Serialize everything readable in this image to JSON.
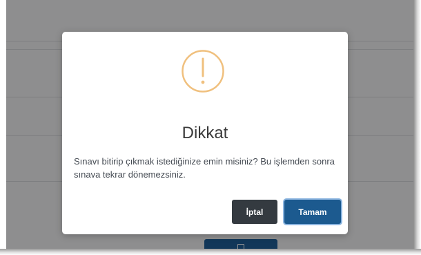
{
  "modal": {
    "title": "Dikkat",
    "message": "Sınavı bitirip çıkmak istediğinize emin misiniz? Bu işlemden sonra sınava tekrar dönemezsiniz.",
    "icon": "warning-icon",
    "buttons": {
      "cancel_label": "İptal",
      "ok_label": "Tamam"
    }
  },
  "colors": {
    "warning_accent": "#f0c07e",
    "cancel_bg": "#343a40",
    "ok_bg": "#1c5a8f"
  }
}
